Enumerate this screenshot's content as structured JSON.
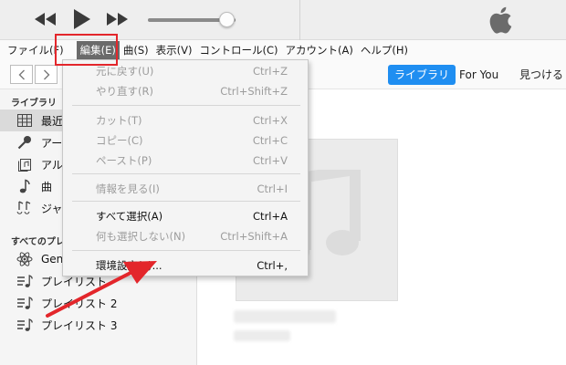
{
  "menubar": {
    "items": [
      {
        "label": "ファイル(F)"
      },
      {
        "label": "編集(E)"
      },
      {
        "label": "曲(S)"
      },
      {
        "label": "表示(V)"
      },
      {
        "label": "コントロール(C)"
      },
      {
        "label": "アカウント(A)"
      },
      {
        "label": "ヘルプ(H)"
      }
    ]
  },
  "edit_menu": {
    "items": [
      {
        "label": "元に戻す(U)",
        "shortcut": "Ctrl+Z",
        "enabled": false
      },
      {
        "label": "やり直す(R)",
        "shortcut": "Ctrl+Shift+Z",
        "enabled": false
      },
      {
        "label": "カット(T)",
        "shortcut": "Ctrl+X",
        "enabled": false
      },
      {
        "label": "コピー(C)",
        "shortcut": "Ctrl+C",
        "enabled": false
      },
      {
        "label": "ペースト(P)",
        "shortcut": "Ctrl+V",
        "enabled": false
      },
      {
        "label": "情報を見る(I)",
        "shortcut": "Ctrl+I",
        "enabled": false
      },
      {
        "label": "すべて選択(A)",
        "shortcut": "Ctrl+A",
        "enabled": true
      },
      {
        "label": "何も選択しない(N)",
        "shortcut": "Ctrl+Shift+A",
        "enabled": false
      },
      {
        "label": "環境設定(F)...",
        "shortcut": "Ctrl+,",
        "enabled": true
      }
    ]
  },
  "nav_tabs": [
    {
      "label": "ライブラリ",
      "active": true
    },
    {
      "label": "For You",
      "active": false
    },
    {
      "label": "見つける",
      "active": false
    }
  ],
  "sidebar": {
    "library_header": "ライブラリ",
    "library_items": [
      {
        "label": "最近",
        "icon": "recent-grid-icon"
      },
      {
        "label": "アー",
        "icon": "microphone-icon"
      },
      {
        "label": "アル",
        "icon": "album-icon"
      },
      {
        "label": "曲",
        "icon": "music-note-icon"
      },
      {
        "label": "ジャ",
        "icon": "genre-icon"
      }
    ],
    "playlists_header": "すべてのプレ",
    "playlist_items": [
      {
        "label": "Gen",
        "icon": "atom-icon"
      },
      {
        "label": "プレイリスト",
        "icon": "playlist-icon"
      },
      {
        "label": "プレイリスト 2",
        "icon": "playlist-icon"
      },
      {
        "label": "プレイリスト 3",
        "icon": "playlist-icon"
      }
    ]
  },
  "player": {
    "volume_level": 0.9
  },
  "colors": {
    "accent": "#1f8ef1",
    "annotation": "#e3262b",
    "menu_highlight": "#6a6a6a"
  }
}
